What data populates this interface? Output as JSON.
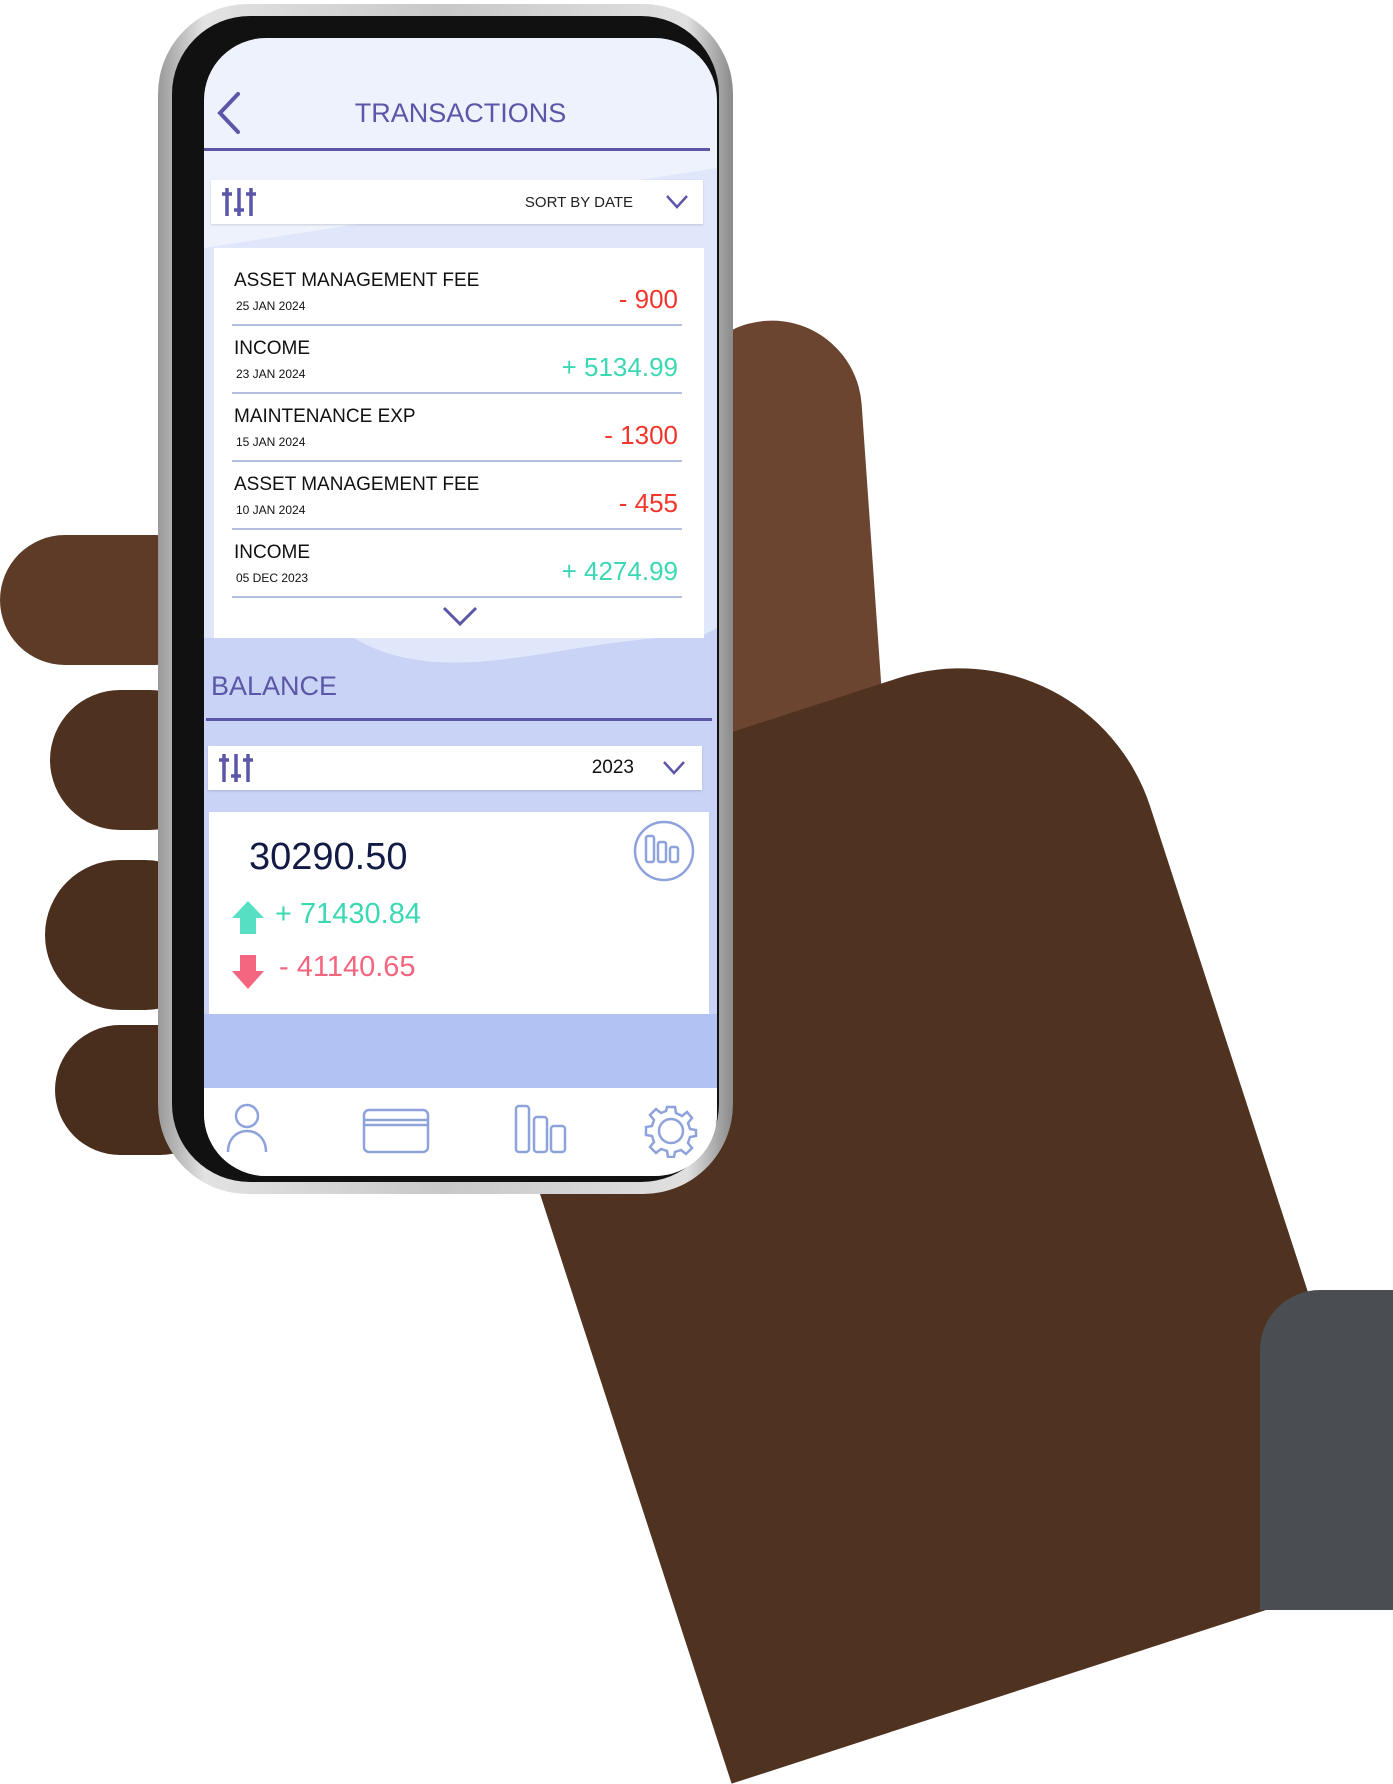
{
  "header": {
    "title": "TRANSACTIONS",
    "back_icon": "chevron-left-icon"
  },
  "transactions": {
    "sort_label": "SORT BY DATE",
    "items": [
      {
        "name": "ASSET MANAGEMENT FEE",
        "date": "25 JAN 2024",
        "amount": "- 900",
        "type": "debit"
      },
      {
        "name": "INCOME",
        "date": "23 JAN 2024",
        "amount": "+ 5134.99",
        "type": "credit"
      },
      {
        "name": "MAINTENANCE EXP",
        "date": "15 JAN 2024",
        "amount": "- 1300",
        "type": "debit"
      },
      {
        "name": "ASSET MANAGEMENT FEE",
        "date": "10 JAN 2024",
        "amount": "- 455",
        "type": "debit"
      },
      {
        "name": "INCOME",
        "date": "05 DEC 2023",
        "amount": "+ 4274.99",
        "type": "credit"
      }
    ]
  },
  "balance": {
    "title": "BALANCE",
    "year": "2023",
    "total": "30290.50",
    "income": "+ 71430.84",
    "expense": "- 41140.65"
  },
  "nav": {
    "items": [
      "profile-icon",
      "card-icon",
      "chart-icon",
      "settings-icon"
    ]
  },
  "colors": {
    "accent": "#5b56a8",
    "credit": "#3bd8b3",
    "debit": "#f2362c",
    "expense": "#f4667f",
    "nav_icon": "#8ea2dc"
  }
}
